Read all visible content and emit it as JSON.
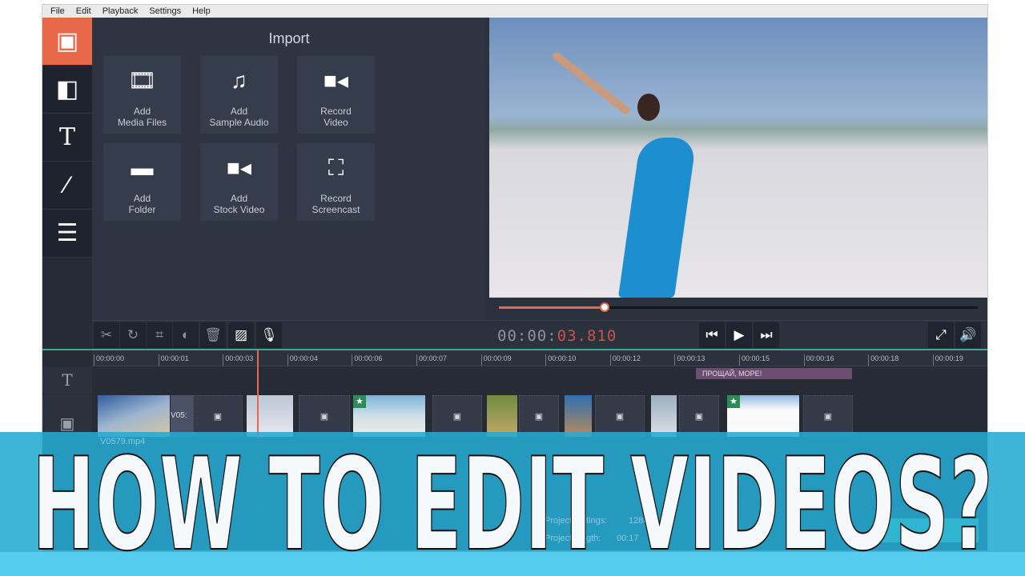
{
  "menu": [
    "File",
    "Edit",
    "Playback",
    "Settings",
    "Help"
  ],
  "sidebar": [
    {
      "icon": "film-icon",
      "active": true
    },
    {
      "icon": "filters-icon"
    },
    {
      "icon": "text-icon"
    },
    {
      "icon": "magic-wand-icon"
    },
    {
      "icon": "menu-icon"
    }
  ],
  "import": {
    "title": "Import",
    "tiles": [
      {
        "icon": "media-files-icon",
        "line1": "Add",
        "line2": "Media Files"
      },
      {
        "icon": "music-icon",
        "line1": "Add",
        "line2": "Sample Audio"
      },
      {
        "icon": "camera-icon",
        "line1": "Record",
        "line2": "Video"
      },
      {
        "icon": "folder-icon",
        "line1": "Add",
        "line2": "Folder"
      },
      {
        "icon": "stock-video-icon",
        "line1": "Add",
        "line2": "Stock Video"
      },
      {
        "icon": "screencast-icon",
        "line1": "Record",
        "line2": "Screencast"
      }
    ]
  },
  "player": {
    "progress_percent": 22,
    "timecode_main": "00:00:",
    "timecode_red": "03.810"
  },
  "timeline": {
    "ticks": [
      "00:00:00",
      "00:00:01",
      "00:00:03",
      "00:00:04",
      "00:00:06",
      "00:00:07",
      "00:00:09",
      "00:00:10",
      "00:00:12",
      "00:00:13",
      "00:00:15",
      "00:00:16",
      "00:00:18",
      "00:00:19"
    ],
    "title_clip": "ПРОЩАЙ, МОРЕ!",
    "clip_label": "V05:",
    "audio_file": "V0579.mp4"
  },
  "footer": {
    "settings_label": "Project settings:",
    "settings_value": "1280",
    "length_label": "Project length:",
    "length_value": "00:17"
  },
  "overlay": {
    "headline": "HOW TO EDIT VIDEOS?"
  },
  "colors": {
    "accent": "#e8684a",
    "band": "#26aad2",
    "title_clip": "#6b4d72"
  }
}
